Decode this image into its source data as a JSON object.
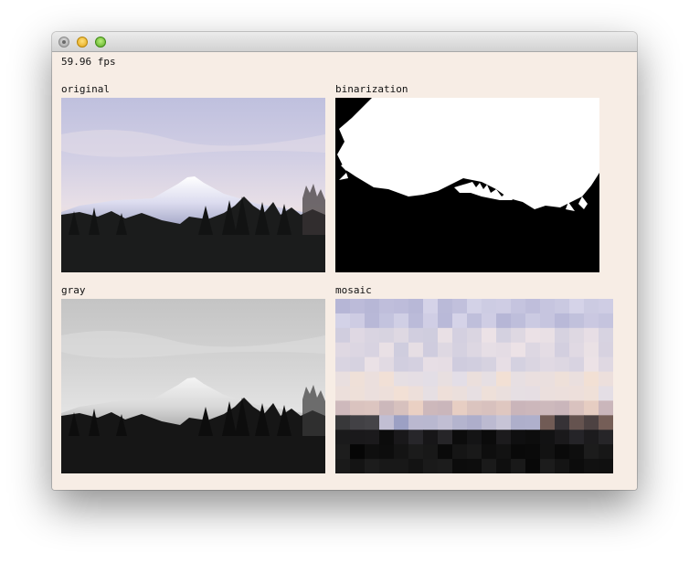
{
  "window": {
    "title": "",
    "fps": "59.96 fps"
  },
  "panels": [
    {
      "id": "original",
      "label": "original"
    },
    {
      "id": "binarization",
      "label": "binarization"
    },
    {
      "id": "gray",
      "label": "gray"
    },
    {
      "id": "mosaic",
      "label": "mosaic"
    }
  ],
  "colors": {
    "window_background": "#f7ede5",
    "titlebar_top": "#ececec",
    "titlebar_bottom": "#d2d2d2",
    "text": "#111111"
  }
}
